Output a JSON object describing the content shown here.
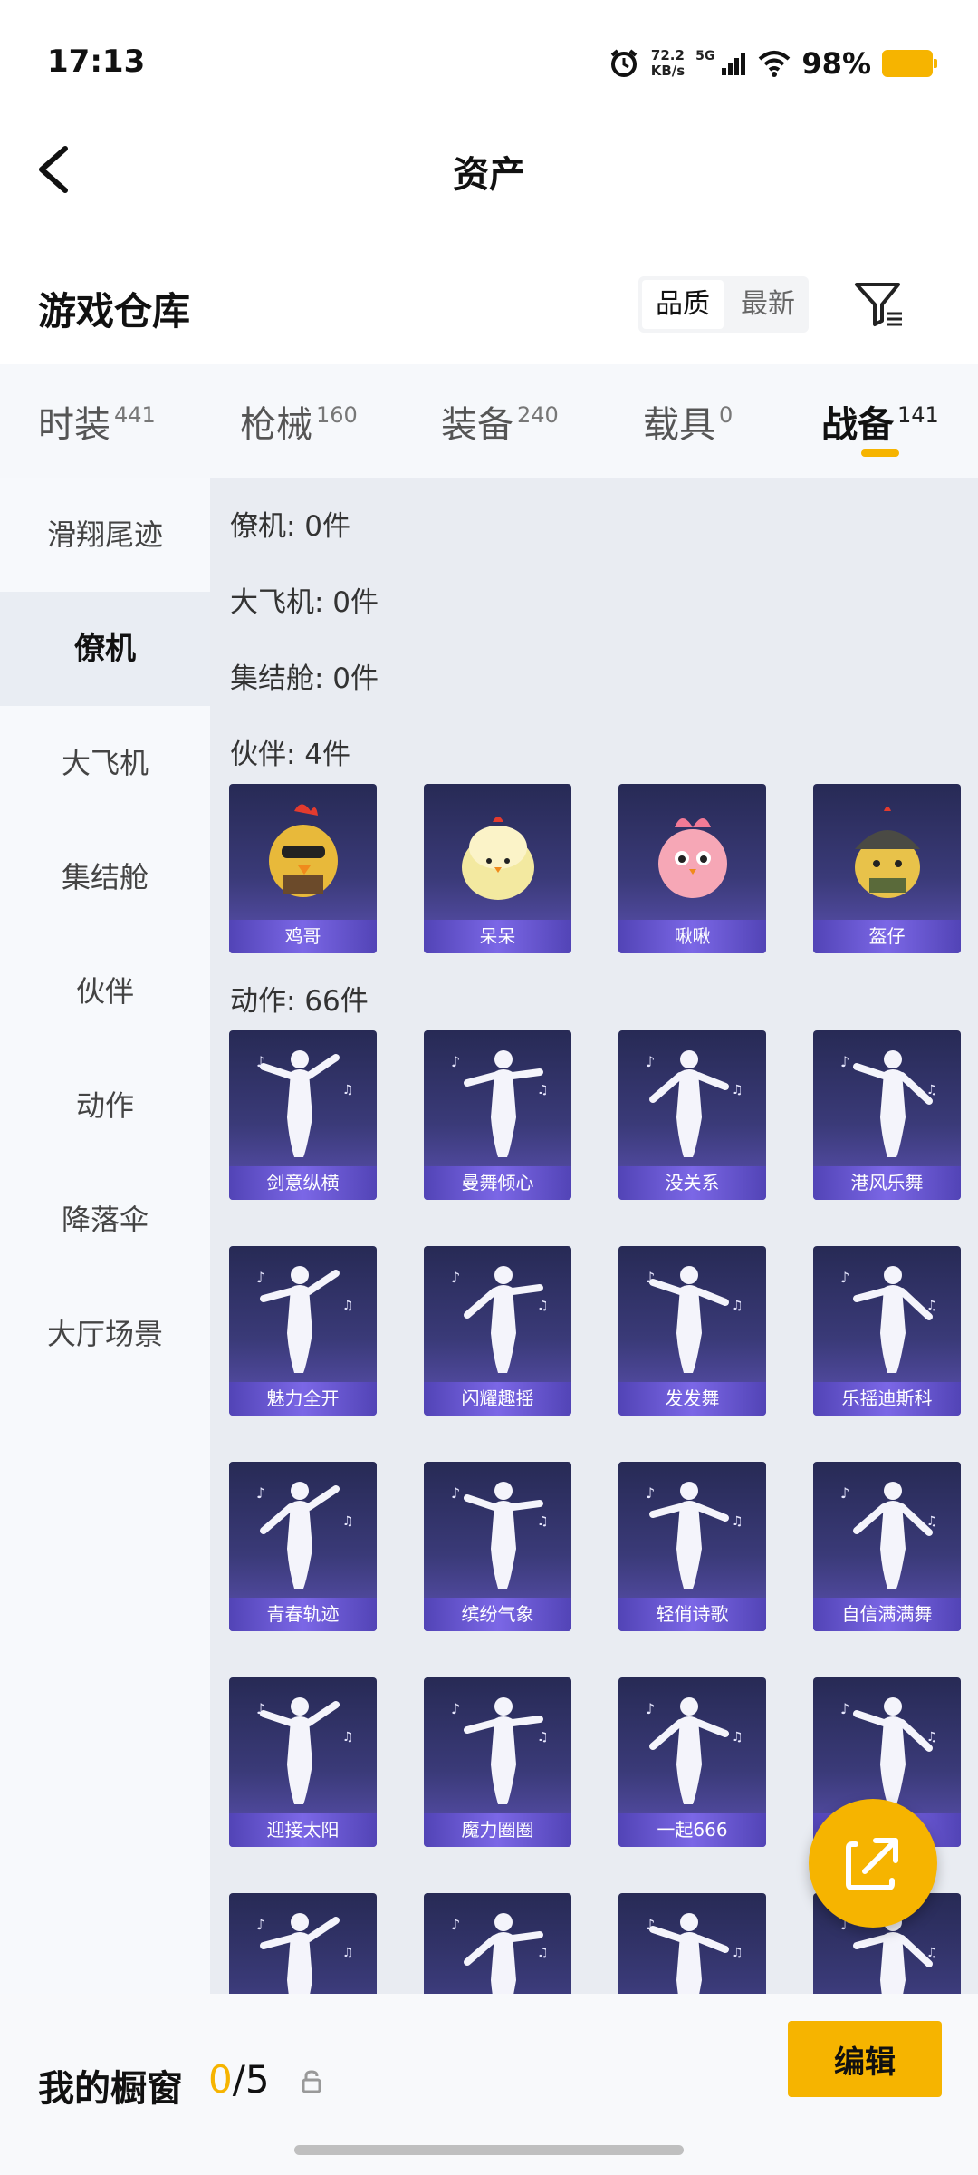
{
  "status": {
    "time": "17:13",
    "net_speed_value": "72.2",
    "net_speed_unit": "KB/s",
    "network": "5G",
    "battery_pct": "98%"
  },
  "header": {
    "title": "资产"
  },
  "warehouse": {
    "title": "游戏仓库",
    "sort_quality": "品质",
    "sort_newest": "最新"
  },
  "tabs": [
    {
      "label": "时装",
      "count": "441"
    },
    {
      "label": "枪械",
      "count": "160"
    },
    {
      "label": "装备",
      "count": "240"
    },
    {
      "label": "载具",
      "count": "0"
    },
    {
      "label": "战备",
      "count": "141"
    }
  ],
  "sidebar": {
    "items": [
      "滑翔尾迹",
      "僚机",
      "大飞机",
      "集结舱",
      "伙伴",
      "动作",
      "降落伞",
      "大厅场景"
    ]
  },
  "sections": {
    "wingman": "僚机: 0件",
    "big_plane": "大飞机: 0件",
    "assembly_pod": "集结舱: 0件",
    "partners": "伙伴: 4件",
    "emotes": "动作: 66件"
  },
  "partners": [
    "鸡哥",
    "呆呆",
    "啾啾",
    "盔仔"
  ],
  "emotes": [
    "剑意纵横",
    "曼舞倾心",
    "没关系",
    "港风乐舞",
    "魅力全开",
    "闪耀趣摇",
    "发发舞",
    "乐摇迪斯科",
    "青春轨迹",
    "缤纷气象",
    "轻俏诗歌",
    "自信满满舞",
    "迎接太阳",
    "魔力圈圈",
    "一起666",
    ""
  ],
  "showcase": {
    "label": "我的橱窗",
    "current": "0",
    "total": "/5"
  },
  "edit_button": "编辑",
  "colors": {
    "accent": "#f6b400",
    "card_top": "#272a55",
    "card_bottom": "#5d52b4"
  }
}
